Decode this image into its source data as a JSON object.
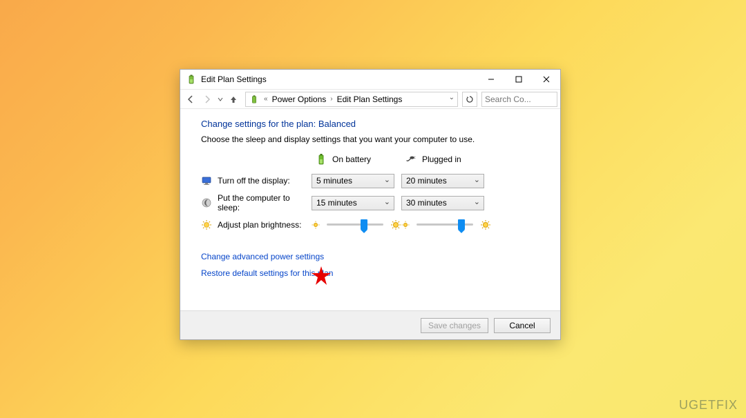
{
  "window": {
    "title": "Edit Plan Settings"
  },
  "nav": {
    "breadcrumb_prefix": "«",
    "breadcrumb1": "Power Options",
    "breadcrumb2": "Edit Plan Settings",
    "search_placeholder": "Search Co..."
  },
  "content": {
    "heading": "Change settings for the plan: Balanced",
    "subheading": "Choose the sleep and display settings that you want your computer to use.",
    "col_battery": "On battery",
    "col_plugged": "Plugged in",
    "rows": {
      "display": {
        "label": "Turn off the display:",
        "battery": "5 minutes",
        "plugged": "20 minutes"
      },
      "sleep": {
        "label": "Put the computer to sleep:",
        "battery": "15 minutes",
        "plugged": "30 minutes"
      },
      "brightness": {
        "label": "Adjust plan brightness:"
      }
    },
    "link_advanced": "Change advanced power settings",
    "link_restore": "Restore default settings for this plan"
  },
  "buttons": {
    "save": "Save changes",
    "cancel": "Cancel"
  },
  "watermark": "UGETFIX"
}
